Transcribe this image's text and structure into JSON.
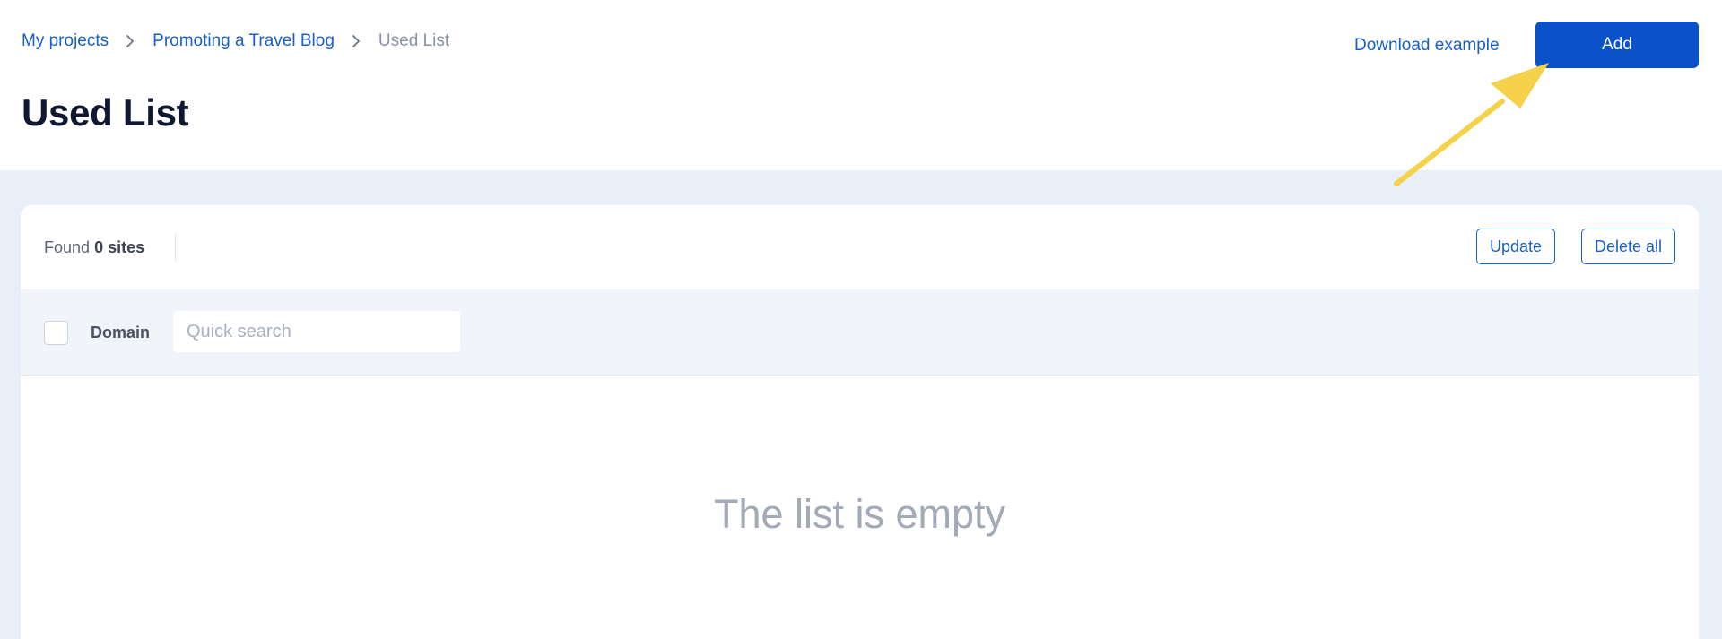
{
  "breadcrumb": {
    "items": [
      {
        "label": "My projects"
      },
      {
        "label": "Promoting a Travel Blog"
      },
      {
        "label": "Used List"
      }
    ]
  },
  "header": {
    "title": "Used List",
    "download_label": "Download example",
    "add_label": "Add"
  },
  "toolbar": {
    "found_prefix": "Found",
    "found_count": "0 sites",
    "update_label": "Update",
    "delete_all_label": "Delete all"
  },
  "table": {
    "column_domain": "Domain",
    "search_placeholder": "Quick search",
    "search_value": ""
  },
  "empty_state": {
    "message": "The list is empty"
  },
  "colors": {
    "accent": "#0a52c7",
    "link": "#1a5fc8",
    "page_background": "#e8eff8",
    "annotation_arrow": "#f5d24a"
  },
  "icons": {
    "breadcrumb_separator": "chevron-right-icon"
  }
}
